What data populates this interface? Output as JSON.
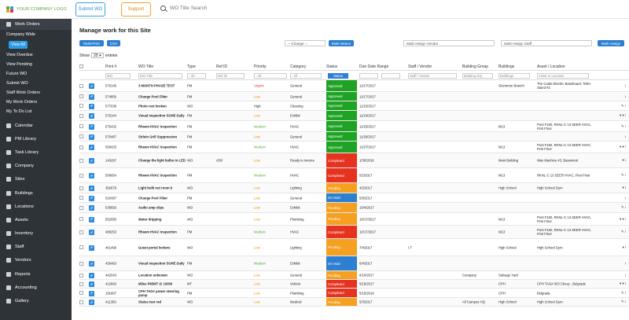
{
  "header": {
    "logo_text": "YOUR COMPANY LOGO",
    "submit_wo": "Submit WO",
    "support": "Support",
    "search_placeholder": "WO Title Search"
  },
  "sidebar": {
    "section": "Work Orders",
    "company_wide": "Company Wide",
    "view_all": "View All",
    "links": [
      "View Overdue",
      "View Pending",
      "Future WO",
      "Submit WO",
      "Staff Work Orders",
      "My Work Orders",
      "My To Do List"
    ],
    "modules": [
      "Calendar",
      "PM Library",
      "Task Library",
      "Company",
      "Sites",
      "Buildings",
      "Locations",
      "Assets",
      "Inventory",
      "Staff",
      "Vendors",
      "Reports",
      "Accounting",
      "Gallery"
    ]
  },
  "main": {
    "title": "Manage work for this Site",
    "multi_print": "Multi-Print",
    "csv": "CSV",
    "change_select": "-- Change --",
    "multi_status": "Multi-Status",
    "multi_assign_vendor": "Multi Assign Vendor",
    "multi_assign_staff": "Multi Assign Staff",
    "multi_assign": "Multi Assign",
    "show_label": "Show",
    "show_value": "25",
    "entries_label": "entries"
  },
  "table": {
    "headers": [
      "Print #",
      "WO Title",
      "Type",
      "Ref ID",
      "Priority",
      "Category",
      "Status",
      "Due Date Range",
      "Staff / Vendor",
      "Building Group",
      "Buildings",
      "Asset / Location"
    ],
    "filters": {
      "print": "WO",
      "title": "WO Title",
      "type": "- All -",
      "ref": "Ref ID",
      "priority": "- All -",
      "category": "- All -",
      "status": "Status",
      "staff": "Staff / Vendor",
      "bgroup": "Building Grp",
      "buildings": "Buildings",
      "asset": "Asset or Location"
    },
    "rows": [
      {
        "id": "579145",
        "title": "3 MONTH PHASE TEST",
        "type": "PM",
        "ref": "",
        "priority": "Urgent",
        "category": "General",
        "status": "Approved",
        "due": "11/17/2017",
        "staff": "",
        "bgroup": "",
        "building": "Glenmore Branch",
        "asset": "The Cadet Electric Baseboard, Teller Stand #2",
        "actions": "i"
      },
      {
        "id": "574856",
        "title": "Change Pool Filter",
        "type": "PM",
        "ref": "",
        "priority": "Low",
        "category": "General",
        "status": "Approved",
        "due": "11/17/2017",
        "staff": "",
        "bgroup": "",
        "building": "",
        "asset": "",
        "actions": "i"
      },
      {
        "id": "577036",
        "title": "Photo rest broken",
        "type": "WO",
        "ref": "",
        "priority": "High",
        "category": "Cleaning",
        "status": "Approved",
        "due": "11/15/2017",
        "staff": "",
        "bgroup": "",
        "building": "",
        "asset": "",
        "actions": "✎ i"
      },
      {
        "id": "579144",
        "title": "Visual Inspection SOHE Daily",
        "type": "PM",
        "ref": "",
        "priority": "Low",
        "category": "Exhibit",
        "status": "Approved",
        "due": "11/19/2017",
        "staff": "",
        "bgroup": "",
        "building": "",
        "asset": "",
        "actions": "▾ ▾ i"
      },
      {
        "id": "575432",
        "title": "Rheem HVAC Inspection",
        "type": "PM",
        "ref": "",
        "priority": "Medium",
        "category": "HVAC",
        "status": "Approved",
        "due": "11/25/2017",
        "staff": "",
        "bgroup": "",
        "building": "M13",
        "asset": "Pont F150, RKNL-C 13 SEER HVAC, First Floor",
        "actions": "✎ i"
      },
      {
        "id": "570487",
        "title": "Sirloin Grill Suppression",
        "type": "PM",
        "ref": "",
        "priority": "Low",
        "category": "General",
        "status": "Approved",
        "due": "11/26/2017",
        "staff": "",
        "bgroup": "",
        "building": "",
        "asset": "",
        "actions": "i"
      },
      {
        "id": "569425",
        "title": "Rheem HVAC Inspection",
        "type": "PM",
        "ref": "",
        "priority": "Medium",
        "category": "HVAC",
        "status": "Approved",
        "due": "11/27/2017",
        "staff": "",
        "bgroup": "",
        "building": "M13",
        "asset": "Pont F150, RKNL-C 13 SEER HVAC, First Floor",
        "actions": "▾ ▾ i"
      },
      {
        "id": "140297",
        "title": "Change the light bulbs to LED",
        "type": "WO",
        "ref": "c/90",
        "priority": "Low",
        "category": "Ready to invoice",
        "status": "Completed",
        "due": "1/30/2016",
        "staff": "",
        "bgroup": "",
        "building": "Main Building",
        "asset": "Wax Machine #3, Basement",
        "actions": "▾ i"
      },
      {
        "id": "506654",
        "title": "Rheem HVAC Inspection",
        "type": "PM",
        "ref": "",
        "priority": "Medium",
        "category": "HVAC",
        "status": "Completed",
        "due": "5/2/2017",
        "staff": "",
        "bgroup": "",
        "building": "M13",
        "asset": "RKNL-C 13 SEER HVAC, First Floor",
        "actions": "✎ i"
      },
      {
        "id": "392679",
        "title": "Light bulb out room 6",
        "type": "WO",
        "ref": "",
        "priority": "Low",
        "category": "Lighting",
        "status": "Pending",
        "due": "4/2/2017",
        "staff": "",
        "bgroup": "",
        "building": "High School",
        "asset": "High School Gym",
        "actions": "▾ i"
      },
      {
        "id": "516487",
        "title": "Change Pool Filter",
        "type": "PM",
        "ref": "",
        "priority": "Low",
        "category": "General",
        "status": "On Hold",
        "due": "5/9/2017",
        "staff": "",
        "bgroup": "",
        "building": "",
        "asset": "",
        "actions": "i"
      },
      {
        "id": "538556",
        "title": "Audio amp clips",
        "type": "WO",
        "ref": "",
        "priority": "Low",
        "category": "Exhibit",
        "status": "Pending",
        "due": "10/4/2017",
        "staff": "",
        "bgroup": "",
        "building": "",
        "asset": "",
        "actions": "✎ i"
      },
      {
        "id": "552050",
        "title": "Water dripping",
        "type": "WO",
        "ref": "",
        "priority": "Low",
        "category": "Plumbing",
        "status": "Pending",
        "due": "10/17/2017",
        "staff": "",
        "bgroup": "",
        "building": "M13",
        "asset": "Pont F150, RKNL-C 13 SEER HVAC, First Floor",
        "actions": "▾ ▾ i"
      },
      {
        "id": "488253",
        "title": "Rheem HVAC Inspection",
        "type": "PM",
        "ref": "",
        "priority": "Medium",
        "category": "HVAC",
        "status": "Completed",
        "due": "10/17/2017",
        "staff": "",
        "bgroup": "",
        "building": "M13",
        "asset": "Pont F150, RKNL-C 13 SEER HVAC, First Floor",
        "actions": "✎ i"
      },
      {
        "id": "461499",
        "title": "Guest portal lockers",
        "type": "WO",
        "ref": "",
        "priority": "Low",
        "category": "Lighting",
        "status": "Pending",
        "due": "7/4/2017",
        "staff": "I.T",
        "bgroup": "",
        "building": "High School",
        "asset": "High School Gym",
        "actions": "▾ i"
      },
      {
        "id": "436463",
        "title": "Visual Inspection SOHE Daily",
        "type": "PM",
        "ref": "",
        "priority": "Medium",
        "category": "Exhibit",
        "status": "On Hold",
        "due": "6/4/2017",
        "staff": "",
        "bgroup": "",
        "building": "",
        "asset": "",
        "actions": "i"
      },
      {
        "id": "442043",
        "title": "Location unknown",
        "type": "WO",
        "ref": "",
        "priority": "Low",
        "category": "General",
        "status": "Pending",
        "due": "6/10/2017",
        "staff": "",
        "bgroup": "Company",
        "building": "Salvage Yard",
        "asset": "",
        "actions": "i"
      },
      {
        "id": "422893",
        "title": "Miles PM/MT @ 10000",
        "type": "MT",
        "ref": "",
        "priority": "Low",
        "category": "Vehicle",
        "status": "Completed",
        "due": "5/18/2017",
        "staff": "",
        "bgroup": "",
        "building": "CPH",
        "asset": "CPH TAG# 003 Chevy , Belgrade",
        "actions": "▾ ▾ i"
      },
      {
        "id": "181807",
        "title": "CPH TAG# power steering pump",
        "type": "PM",
        "ref": "",
        "priority": "Low",
        "category": "Plumbing",
        "status": "Completed",
        "due": "5/15/2014",
        "staff": "",
        "bgroup": "",
        "building": "CPH",
        "asset": "Belgrade",
        "actions": "✎ i"
      },
      {
        "id": "411359",
        "title": "Status test red",
        "type": "WO",
        "ref": "",
        "priority": "Low",
        "category": "Medical",
        "status": "Pending",
        "due": "5/3/2017",
        "staff": "",
        "bgroup": "All Campus HQ",
        "building": "High School",
        "asset": "High School Gym",
        "actions": "✎ i"
      }
    ]
  },
  "colors": {
    "accent": "#2d7fd0",
    "sidebar": "#2e3338",
    "Approved": "#1fa324",
    "Completed": "#e5331f",
    "Pending": "#f5a020",
    "On Hold": "#2d7fd0",
    "Urgent": "#e5331f",
    "Low": "#f08a00",
    "Medium": "#5aa832",
    "High": "#222222"
  }
}
